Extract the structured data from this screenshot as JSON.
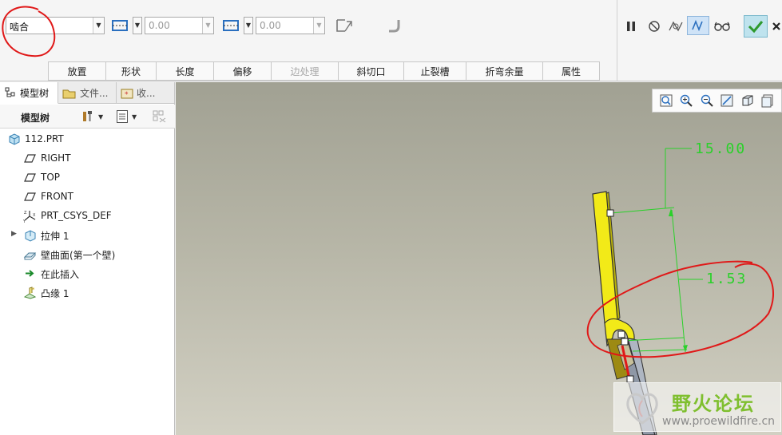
{
  "dashboard": {
    "type_select": {
      "value": "啮合"
    },
    "thickness_value_1": "0.00",
    "thickness_value_2": "0.00",
    "tabs": [
      {
        "label": "放置",
        "enabled": true
      },
      {
        "label": "形状",
        "enabled": true
      },
      {
        "label": "长度",
        "enabled": true
      },
      {
        "label": "偏移",
        "enabled": true
      },
      {
        "label": "边处理",
        "enabled": false
      },
      {
        "label": "斜切口",
        "enabled": true
      },
      {
        "label": "止裂槽",
        "enabled": true
      },
      {
        "label": "折弯余量",
        "enabled": true
      },
      {
        "label": "属性",
        "enabled": true
      }
    ],
    "right_icons": [
      "pause-icon",
      "no-entry-icon",
      "preview-icon",
      "verify-icon",
      "glasses-icon",
      "confirm-check-icon",
      "cancel-x-icon"
    ]
  },
  "navigator": {
    "tabs": [
      {
        "label": "模型树",
        "icon": "model-tree-icon",
        "active": true
      },
      {
        "label": "文件...",
        "icon": "folder-icon",
        "active": false
      },
      {
        "label": "收...",
        "icon": "favorites-icon",
        "active": false
      }
    ],
    "header_title": "模型树",
    "items": [
      {
        "label": "112.PRT",
        "icon": "part-icon",
        "expandable": false
      },
      {
        "label": "RIGHT",
        "icon": "datum-plane-icon",
        "expandable": false
      },
      {
        "label": "TOP",
        "icon": "datum-plane-icon",
        "expandable": false
      },
      {
        "label": "FRONT",
        "icon": "datum-plane-icon",
        "expandable": false
      },
      {
        "label": "PRT_CSYS_DEF",
        "icon": "coordinate-system-icon",
        "expandable": false
      },
      {
        "label": "拉伸 1",
        "icon": "extrude-icon",
        "expandable": true
      },
      {
        "label": "壁曲面(第一个壁)",
        "icon": "wall-surface-icon",
        "expandable": false
      },
      {
        "label": "在此插入",
        "icon": "insert-here-arrow-icon",
        "expandable": false
      },
      {
        "label": "凸缘 1",
        "icon": "flange-icon",
        "expandable": false
      }
    ]
  },
  "viewport": {
    "dimensions": [
      "15.00",
      "1.53"
    ],
    "watermark": {
      "title": "野火论坛",
      "url": "www.proewildfire.cn"
    }
  },
  "colors": {
    "dimension": "#2ad12a",
    "annotation": "#e01818",
    "model_yellow": "#f2ea18",
    "check_green": "#2e9a2e"
  }
}
